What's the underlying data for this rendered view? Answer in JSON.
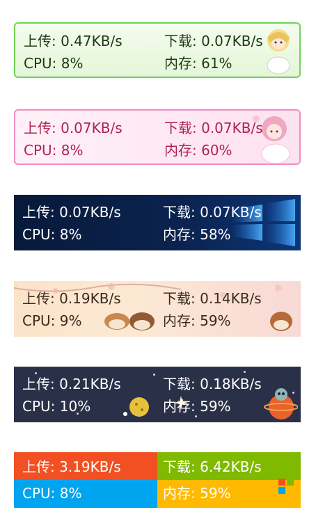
{
  "skins": [
    {
      "upload": "上传: 0.47KB/s",
      "download": "下载: 0.07KB/s",
      "cpu": "CPU: 8%",
      "memory": "内存: 61%"
    },
    {
      "upload": "上传: 0.07KB/s",
      "download": "下载: 0.07KB/s",
      "cpu": "CPU: 8%",
      "memory": "内存: 60%"
    },
    {
      "upload": "上传: 0.07KB/s",
      "download": "下载: 0.07KB/s",
      "cpu": "CPU: 8%",
      "memory": "内存: 58%"
    },
    {
      "upload": "上传: 0.19KB/s",
      "download": "下载: 0.14KB/s",
      "cpu": "CPU: 9%",
      "memory": "内存: 59%"
    },
    {
      "upload": "上传: 0.21KB/s",
      "download": "下载: 0.18KB/s",
      "cpu": "CPU: 10%",
      "memory": "内存: 59%"
    },
    {
      "upload": "上传: 3.19KB/s",
      "download": "下载: 6.42KB/s",
      "cpu": "CPU: 8%",
      "memory": "内存: 59%"
    }
  ],
  "colors": {
    "green_border": "#6fd457",
    "pink_border": "#ee8fc0",
    "win_red": "#f25022",
    "win_green": "#7fba00",
    "win_blue": "#00a4ef",
    "win_yellow": "#ffb900"
  },
  "icons": [
    "anime-girl-icon",
    "anime-girl-pink-icon",
    "windows-logo-icon",
    "bird-icon",
    "space-planet-icon",
    "windows-logo-icon"
  ]
}
